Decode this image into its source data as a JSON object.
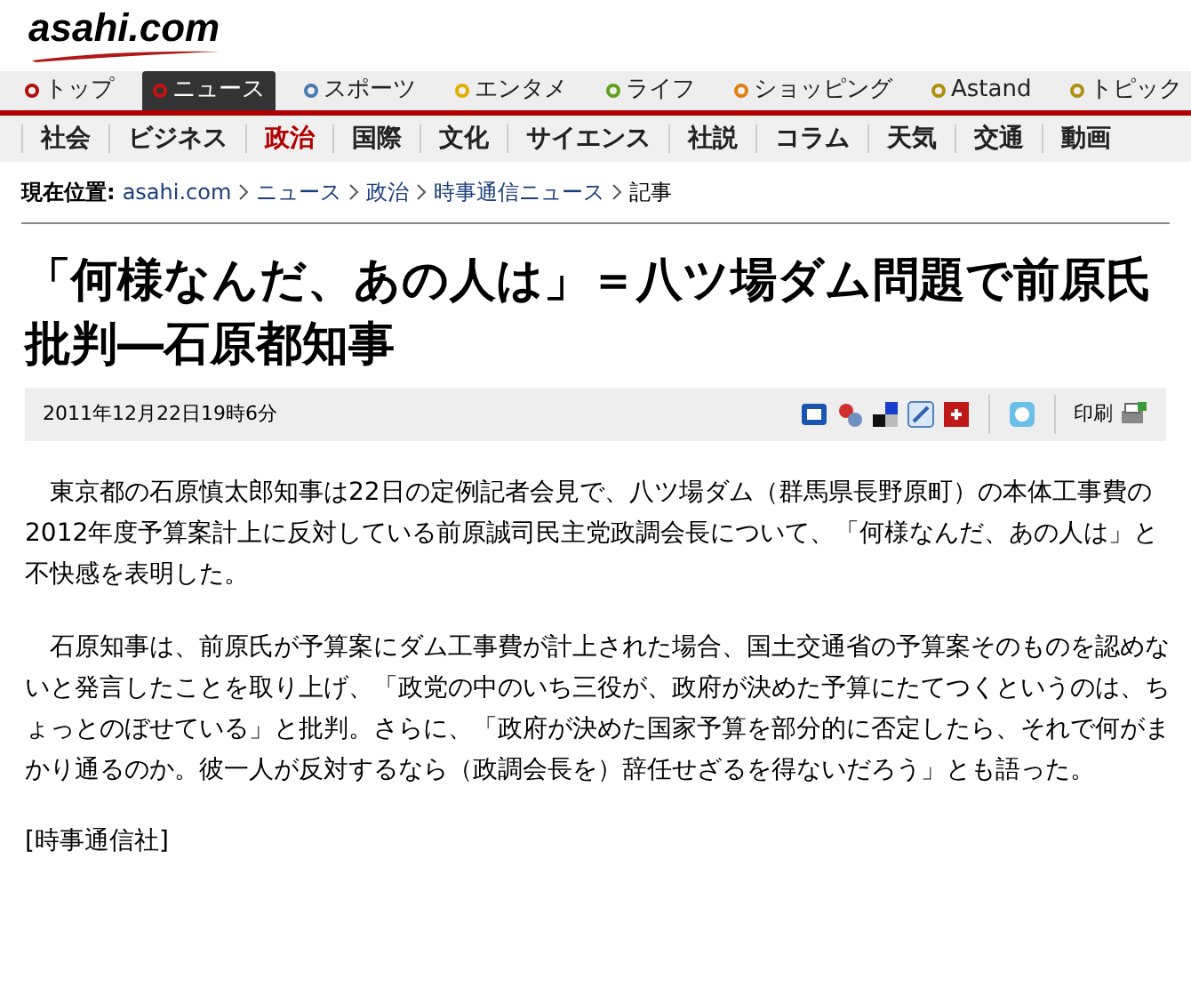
{
  "logo": {
    "text": "asahi.com"
  },
  "main_nav": [
    {
      "label": "トップ",
      "selected": false,
      "color": "#b01010"
    },
    {
      "label": "ニュース",
      "selected": true,
      "color": "#cc1010"
    },
    {
      "label": "スポーツ",
      "selected": false,
      "color": "#4a7ab0"
    },
    {
      "label": "エンタメ",
      "selected": false,
      "color": "#e0b000"
    },
    {
      "label": "ライフ",
      "selected": false,
      "color": "#60a020"
    },
    {
      "label": "ショッピング",
      "selected": false,
      "color": "#e08010"
    },
    {
      "label": "Astand",
      "selected": false,
      "color": "#b09010"
    },
    {
      "label": "トピック",
      "selected": false,
      "color": "#b09010"
    }
  ],
  "sub_nav": [
    {
      "label": "社会",
      "selected": false
    },
    {
      "label": "ビジネス",
      "selected": false
    },
    {
      "label": "政治",
      "selected": true
    },
    {
      "label": "国際",
      "selected": false
    },
    {
      "label": "文化",
      "selected": false
    },
    {
      "label": "サイエンス",
      "selected": false
    },
    {
      "label": "社説",
      "selected": false
    },
    {
      "label": "コラム",
      "selected": false
    },
    {
      "label": "天気",
      "selected": false
    },
    {
      "label": "交通",
      "selected": false
    },
    {
      "label": "動画",
      "selected": false
    }
  ],
  "breadcrumb": {
    "label": "現在位置:",
    "items": [
      {
        "text": "asahi.com",
        "kind": "link"
      },
      {
        "text": "ニュース",
        "kind": "link"
      },
      {
        "text": "政治",
        "kind": "link"
      },
      {
        "text": "時事通信ニュース",
        "kind": "link"
      },
      {
        "text": "記事",
        "kind": "current"
      }
    ]
  },
  "article": {
    "title": "「何様なんだ、あの人は」＝八ツ場ダム問題で前原氏批判―石原都知事",
    "date": "2011年12月22日19時6分",
    "print_label": "印刷",
    "paragraphs": [
      "東京都の石原慎太郎知事は22日の定例記者会見で、八ツ場ダム（群馬県長野原町）の本体工事費の2012年度予算案計上に反対している前原誠司民主党政調会長について、「何様なんだ、あの人は」と不快感を表明した。",
      "石原知事は、前原氏が予算案にダム工事費が計上された場合、国土交通省の予算案そのものを認めないと発言したことを取り上げ、「政党の中のいち三役が、政府が決めた予算にたてつくというのは、ちょっとのぼせている」と批判。さらに、「政府が決めた国家予算を部分的に否定したら、それで何がまかり通るのか。彼一人が反対するなら（政調会長を）辞任せざるを得ないだろう」とも語った。"
    ],
    "source": "[時事通信社]"
  }
}
